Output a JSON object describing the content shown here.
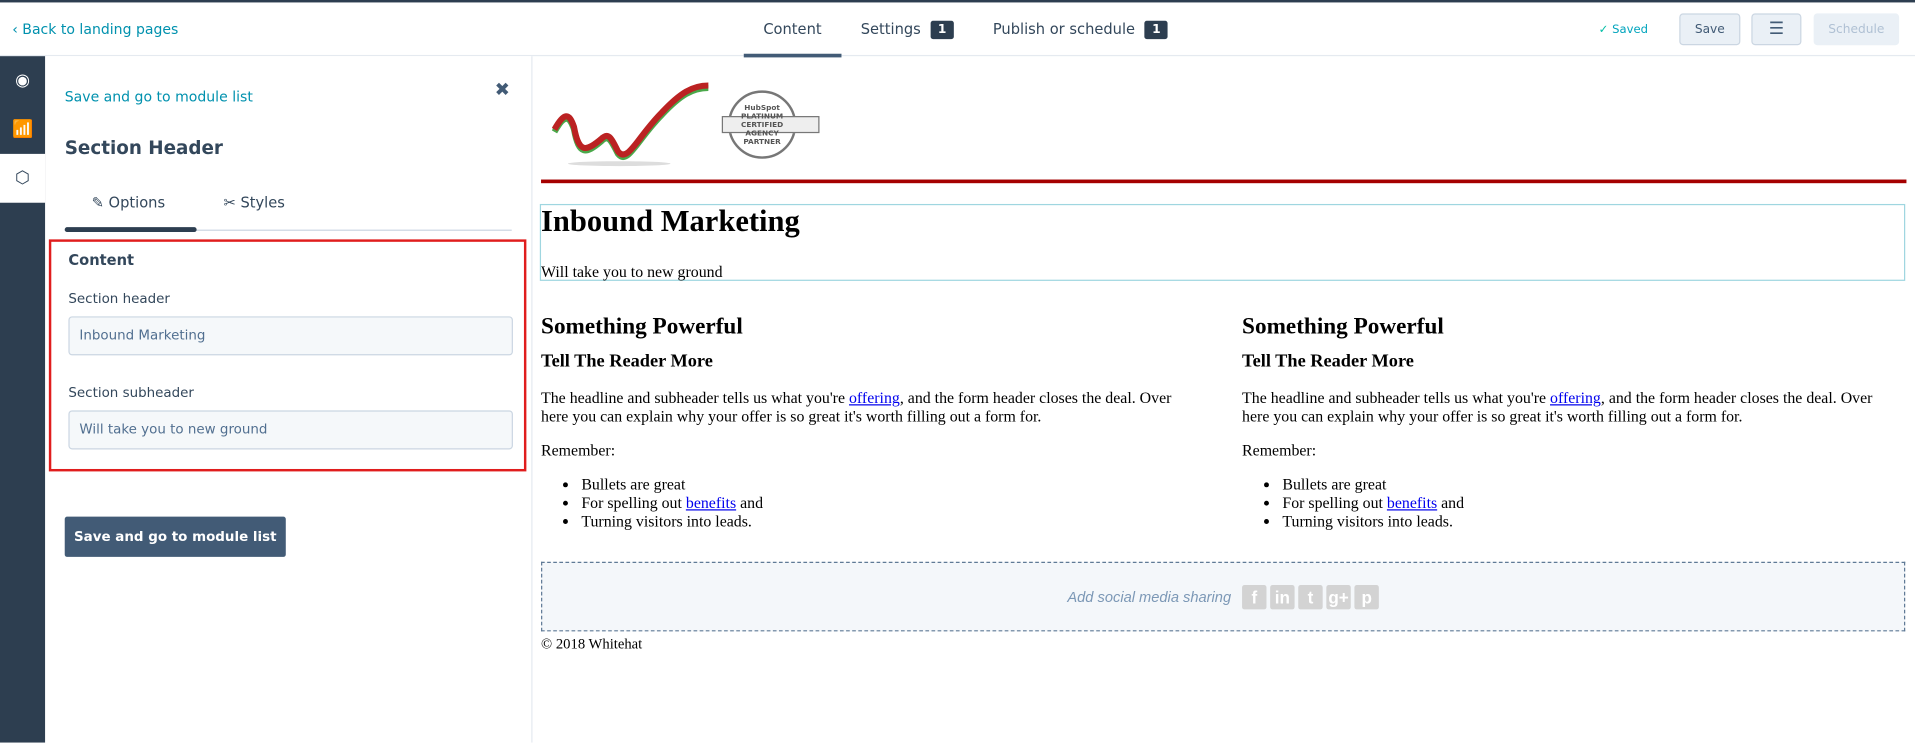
{
  "topbar": {
    "back_label": "Back to landing pages",
    "tabs": [
      {
        "label": "Content"
      },
      {
        "label": "Settings",
        "badge": "1"
      },
      {
        "label": "Publish or schedule",
        "badge": "1"
      }
    ],
    "saved_label": "Saved",
    "save_label": "Save",
    "schedule_label": "Schedule"
  },
  "rail": {
    "icons": [
      "eye-icon",
      "analytics-icon",
      "module-cube-icon"
    ]
  },
  "panel": {
    "save_link": "Save and go to module list",
    "title": "Section Header",
    "tabs": [
      {
        "label": "Options"
      },
      {
        "label": "Styles"
      }
    ],
    "group_label": "Content",
    "fields": [
      {
        "label": "Section header",
        "value": "Inbound Marketing"
      },
      {
        "label": "Section subheader",
        "value": "Will take you to new ground"
      }
    ],
    "save_button": "Save and go to module list"
  },
  "preview": {
    "badge_text": "HubSpot PLATINUM CERTIFIED AGENCY PARTNER",
    "header": "Inbound Marketing",
    "subheader": "Will take you to new ground",
    "columns": [
      {
        "h2": "Something Powerful",
        "h3": "Tell The Reader More",
        "p1a": "The headline and subheader tells us what you're ",
        "link1": "offering",
        "p1b": ", and the form header closes the deal. Over here you can explain why your offer is so great it's worth filling out a form for.",
        "p2": "Remember:",
        "b1": "Bullets are great",
        "b2a": "For spelling out ",
        "link2": "benefits",
        "b2b": " and",
        "b3": "Turning visitors into leads."
      },
      {
        "h2": "Something Powerful",
        "h3": "Tell The Reader More",
        "p1a": "The headline and subheader tells us what you're ",
        "link1": "offering",
        "p1b": ", and the form header closes the deal. Over here you can explain why your offer is so great it's worth filling out a form for.",
        "p2": "Remember:",
        "b1": "Bullets are great",
        "b2a": "For spelling out ",
        "link2": "benefits",
        "b2b": " and",
        "b3": "Turning visitors into leads."
      }
    ],
    "social_label": "Add social media sharing",
    "social_icons": [
      "f",
      "in",
      "t",
      "g+",
      "p"
    ],
    "footer": "© 2018 Whitehat"
  }
}
